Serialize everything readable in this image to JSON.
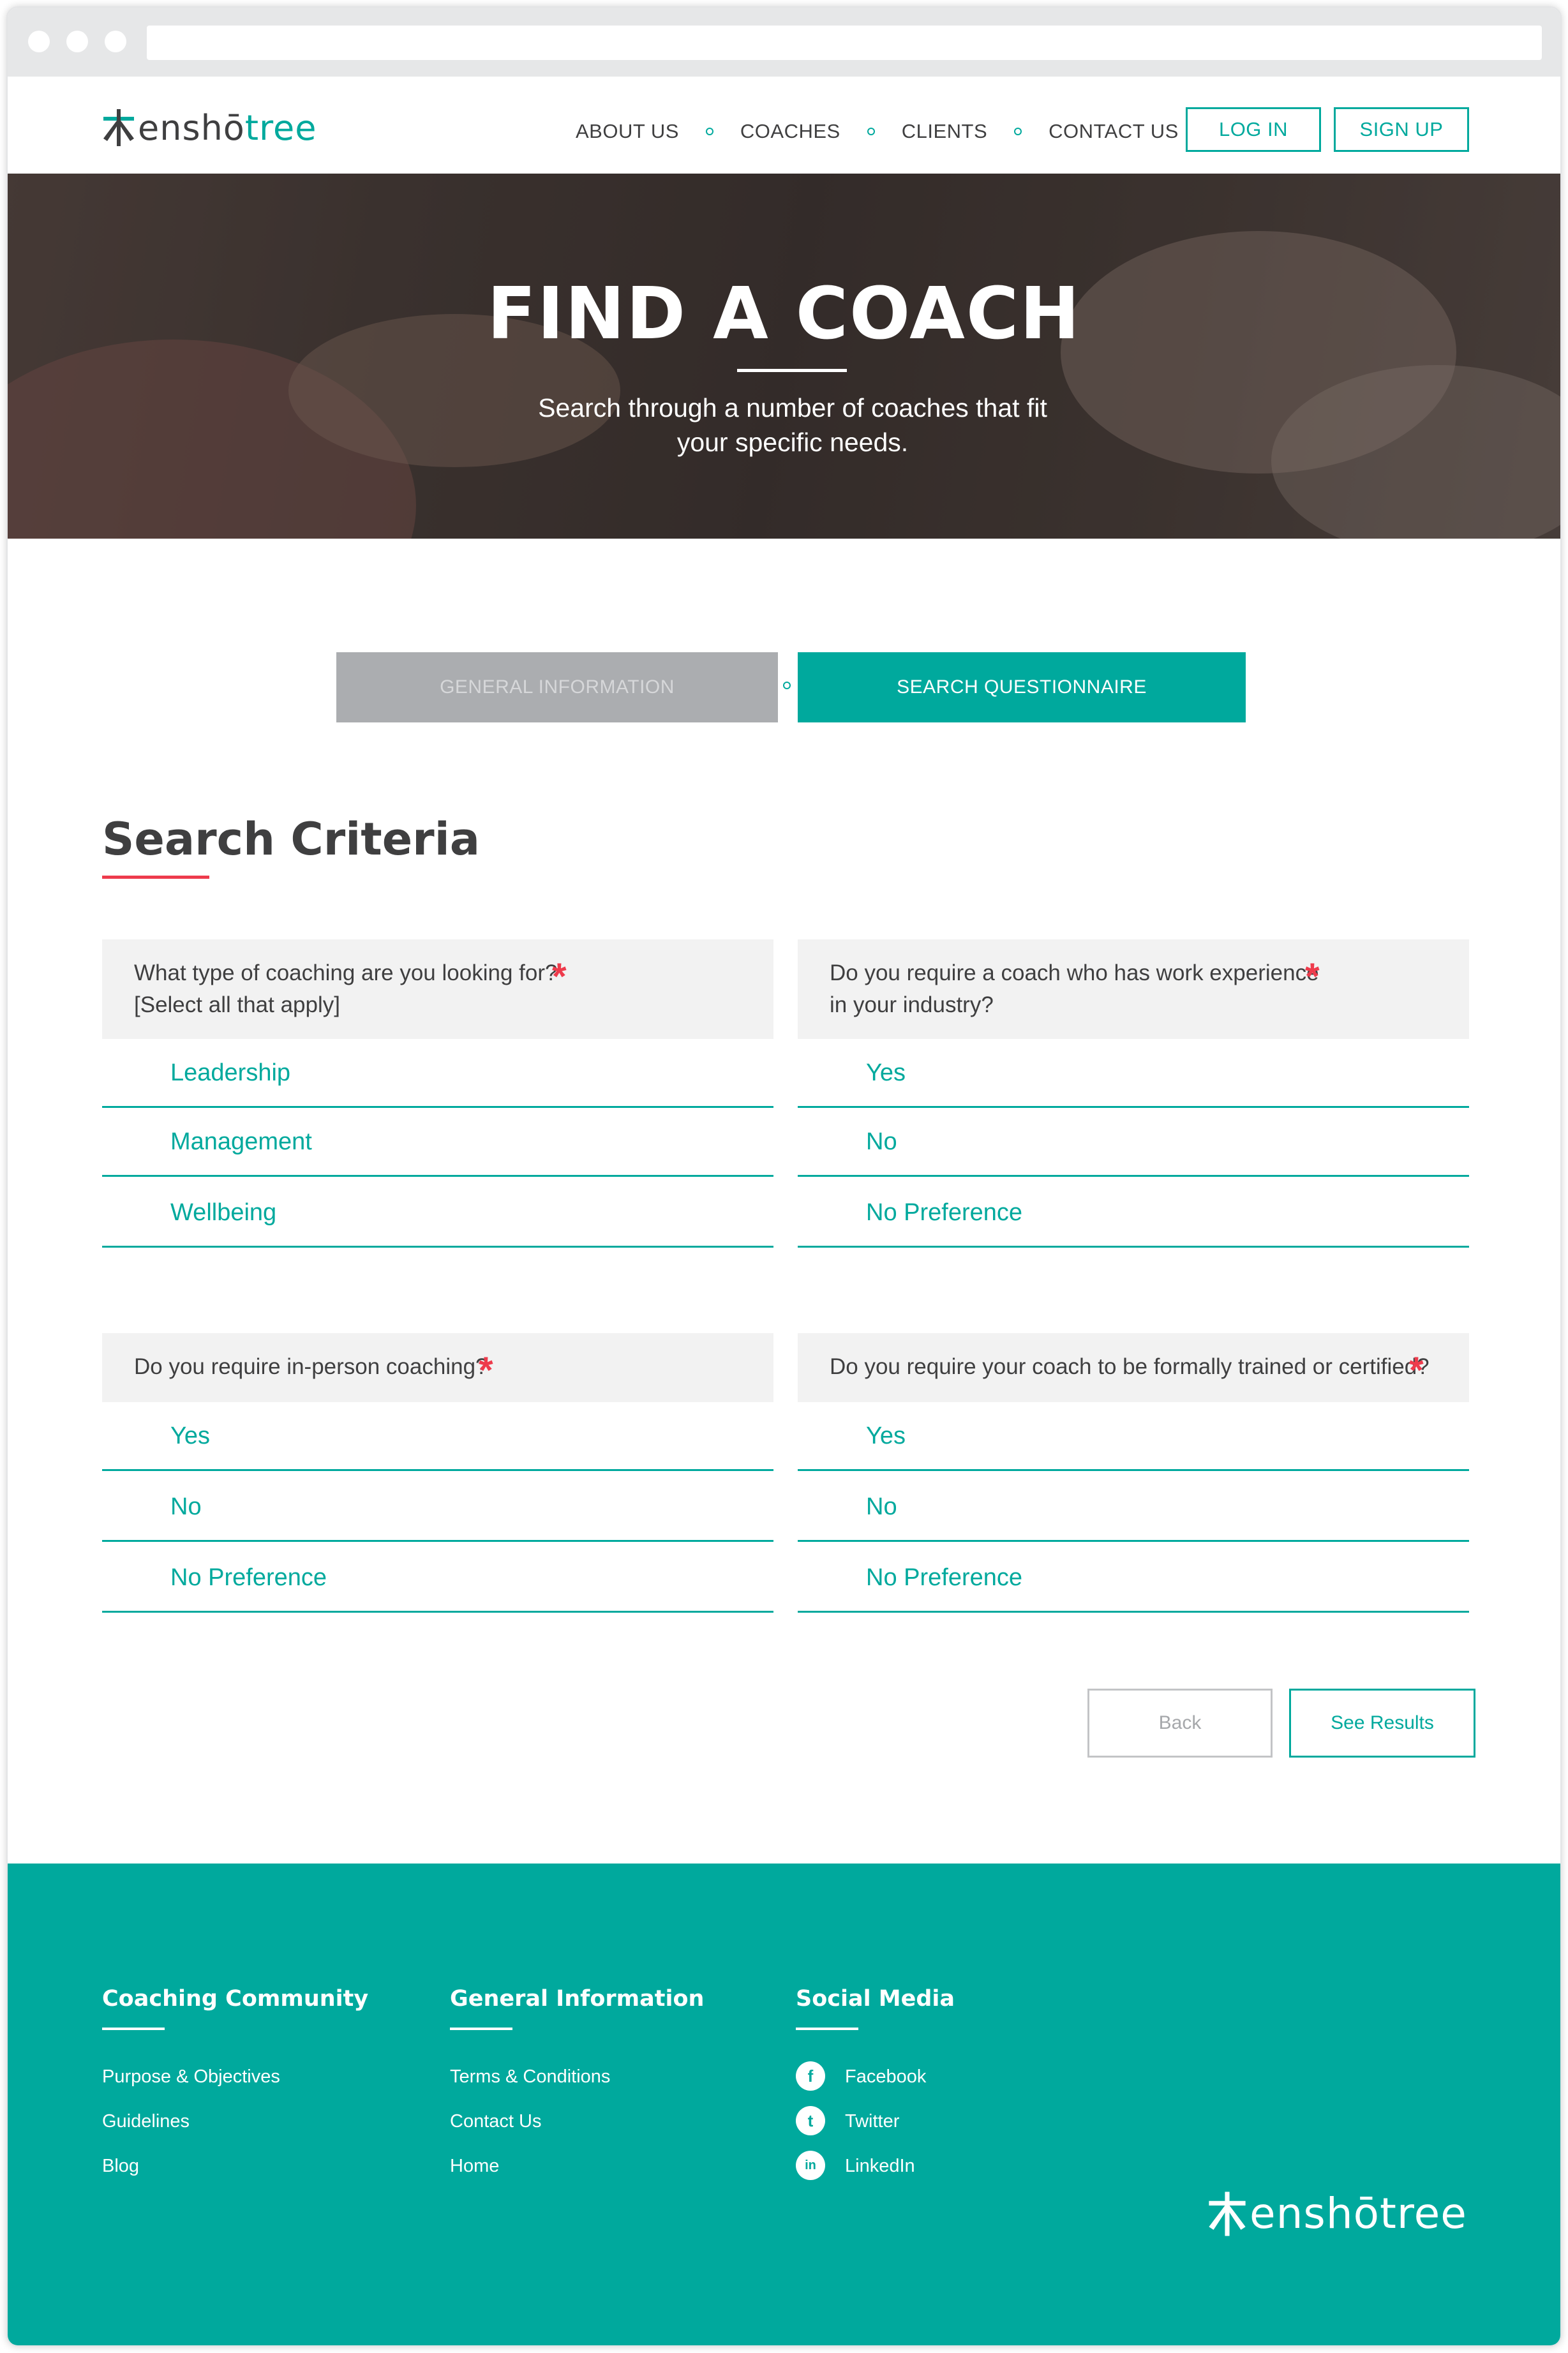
{
  "brand": {
    "logo_part1": "enshō",
    "logo_part2": "tree",
    "footer_logo": "enshōtree",
    "colors": {
      "teal": "#00A99D",
      "red": "#EE3B4C",
      "dark": "#3F3F40",
      "gray": "#ABADB0"
    }
  },
  "nav": {
    "items": [
      {
        "label": "ABOUT US"
      },
      {
        "label": "COACHES"
      },
      {
        "label": "CLIENTS"
      },
      {
        "label": "CONTACT US"
      }
    ],
    "login_label": "LOG IN",
    "signup_label": "SIGN UP"
  },
  "hero": {
    "title": "FIND A COACH",
    "subtitle_line1": "Search through a number of coaches that fit",
    "subtitle_line2": "your specific needs."
  },
  "steps": {
    "general": "GENERAL INFORMATION",
    "questionnaire": "SEARCH QUESTIONNAIRE"
  },
  "section": {
    "title": "Search Criteria"
  },
  "questions": [
    {
      "line1": "What type of coaching are you looking for?",
      "line2": "[Select all that apply]",
      "required_marker": "*",
      "options": [
        "Leadership",
        "Management",
        "Wellbeing"
      ]
    },
    {
      "line1": "Do you require a coach who has work experience",
      "line2": "in your industry?",
      "required_marker": "*",
      "options": [
        "Yes",
        "No",
        "No Preference"
      ]
    },
    {
      "line1": "Do you require in-person coaching?",
      "required_marker": "*",
      "options": [
        "Yes",
        "No",
        "No Preference"
      ]
    },
    {
      "line1": "Do you require your coach to be formally trained or certified?",
      "required_marker": "*",
      "options": [
        "Yes",
        "No",
        "No Preference"
      ]
    }
  ],
  "actions": {
    "back": "Back",
    "results": "See Results"
  },
  "footer": {
    "community": {
      "title": "Coaching Community",
      "links": [
        "Purpose & Objectives",
        "Guidelines",
        "Blog"
      ]
    },
    "general": {
      "title": "General Information",
      "links": [
        "Terms & Conditions",
        "Contact Us",
        "Home"
      ]
    },
    "social": {
      "title": "Social Media",
      "links": [
        {
          "label": "Facebook",
          "icon": "facebook-icon",
          "glyph": "f"
        },
        {
          "label": "Twitter",
          "icon": "twitter-icon",
          "glyph": "t"
        },
        {
          "label": "LinkedIn",
          "icon": "linkedin-icon",
          "glyph": "in"
        }
      ]
    }
  }
}
